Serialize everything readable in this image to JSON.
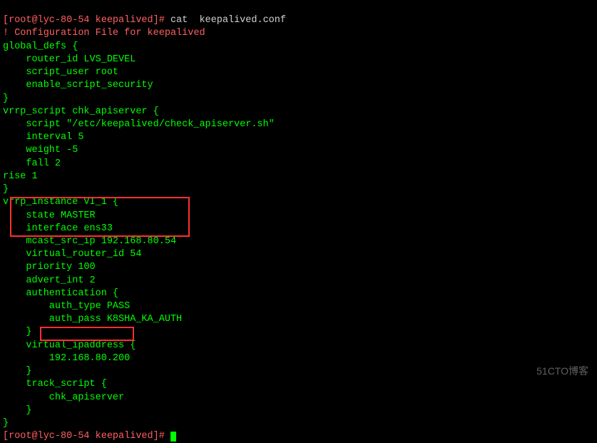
{
  "prompt1": {
    "userhost": "[root@lyc-80-54 keepalived]#",
    "command": "cat  keepalived.conf"
  },
  "config": {
    "comment": "! Configuration File for keepalived",
    "lines": [
      "global_defs {",
      "    router_id LVS_DEVEL",
      "    script_user root",
      "    enable_script_security",
      "}",
      "vrrp_script chk_apiserver {",
      "    script \"/etc/keepalived/check_apiserver.sh\"",
      "    interval 5",
      "    weight -5",
      "    fall 2",
      "rise 1",
      "}",
      "vrrp_instance VI_1 {",
      "    state MASTER",
      "    interface ens33",
      "    mcast_src_ip 192.168.80.54",
      "    virtual_router_id 54",
      "    priority 100",
      "    advert_int 2",
      "    authentication {",
      "        auth_type PASS",
      "        auth_pass K8SHA_KA_AUTH",
      "    }",
      "    virtual_ipaddress {",
      "        192.168.80.200",
      "    }",
      "    track_script {",
      "        chk_apiserver",
      "    }",
      "}"
    ]
  },
  "prompt2": {
    "userhost": "[root@lyc-80-54 keepalived]#"
  },
  "watermark": "51CTO博客"
}
